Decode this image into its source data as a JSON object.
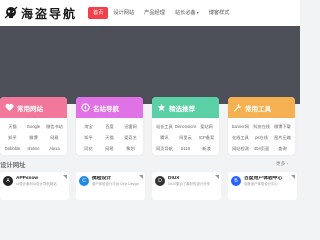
{
  "header": {
    "logo_text": "海盗导航",
    "nav": [
      {
        "label": "首页",
        "active": true
      },
      {
        "label": "设计网站",
        "active": false
      },
      {
        "label": "产品经理",
        "active": false
      },
      {
        "label": "站长必备",
        "active": false,
        "dropdown": true
      },
      {
        "label": "博客样式",
        "active": false
      }
    ]
  },
  "categories": [
    {
      "title": "常用网站",
      "color": "#f1789a",
      "icon": "heart-icon",
      "links": [
        "天猫",
        "Google",
        "微信书站",
        "知乎",
        "微博",
        "网易",
        "Dribbble",
        "timline",
        "Alexa"
      ]
    },
    {
      "title": "名站导航",
      "color": "#e072e6",
      "icon": "compass-icon",
      "links": [
        "淘宝",
        "百度",
        "迅雷网",
        "知乎",
        "天猫",
        "爱奇艺",
        "同花",
        "网易",
        "聚划"
      ]
    },
    {
      "title": "精选推荐",
      "color": "#5bcfa6",
      "icon": "star-icon",
      "links": [
        "站长工具",
        "Dimensions",
        "爱站网",
        "腾讯",
        "阿里云",
        "ICP备案",
        "网页导航",
        "5118",
        "新浪"
      ]
    },
    {
      "title": "常用工具",
      "color": "#f5b151",
      "icon": "wrench-icon",
      "links": [
        "banner网",
        "科技在线",
        "微博下载",
        "在线工具",
        "ps在线",
        "图片压缩",
        "网站检测",
        "404页面",
        "查询"
      ]
    }
  ],
  "section": {
    "title": "设计网址",
    "more": "更多"
  },
  "sites": [
    {
      "name": "APPsnow",
      "desc": "Ui设计素材UI设计导航网站",
      "color": "#222222"
    },
    {
      "name": "携程设计",
      "desc": "用户体验设计平台  Ctrip Design",
      "color": "#1e88e5"
    },
    {
      "name": "DIUX",
      "desc": "DIUX集合了最好的设计分享",
      "color": "#333333"
    },
    {
      "name": "百度用户体验中心",
      "desc": "百度用户体验设计中心",
      "color": "#2962ff"
    }
  ]
}
